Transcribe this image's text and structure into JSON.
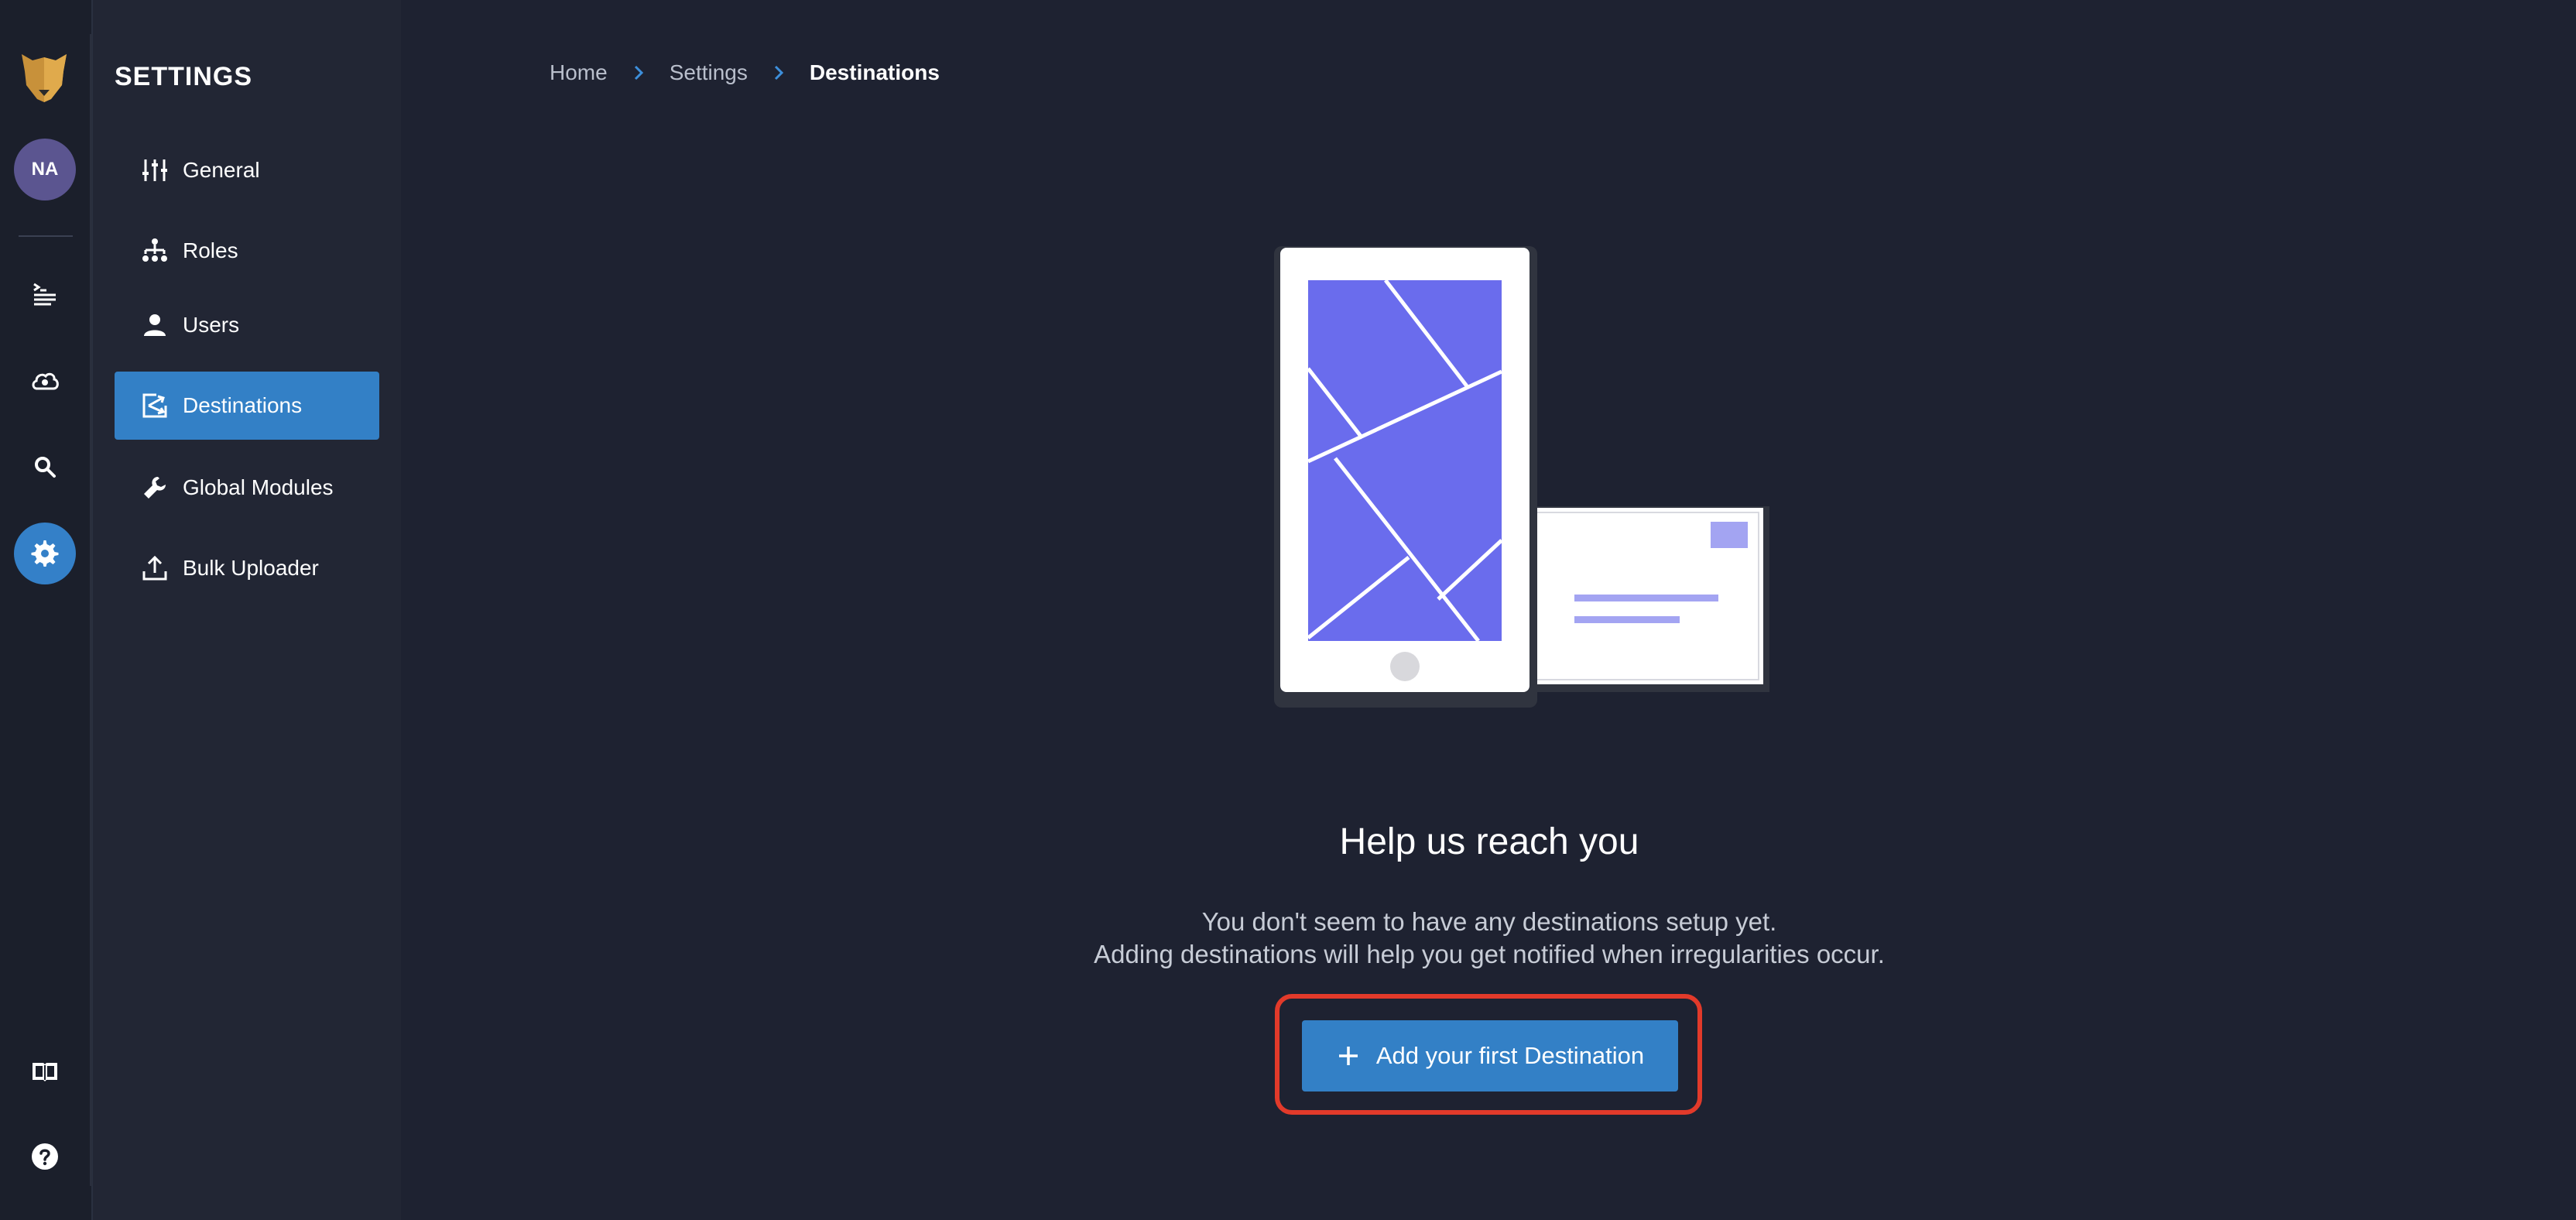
{
  "rail": {
    "avatar_initials": "NA",
    "items": [
      {
        "icon": "logs-icon",
        "active": false
      },
      {
        "icon": "cloud-eye-icon",
        "active": false
      },
      {
        "icon": "search-icon",
        "active": false
      },
      {
        "icon": "gear-icon",
        "active": true
      }
    ],
    "bottom_items": [
      {
        "icon": "book-icon"
      },
      {
        "icon": "help-icon"
      }
    ]
  },
  "sidebar": {
    "title": "SETTINGS",
    "items": [
      {
        "label": "General",
        "icon": "sliders-icon",
        "active": false
      },
      {
        "label": "Roles",
        "icon": "hierarchy-icon",
        "active": false
      },
      {
        "label": "Users",
        "icon": "user-icon",
        "active": false
      },
      {
        "label": "Destinations",
        "icon": "destinations-icon",
        "active": true
      },
      {
        "label": "Global Modules",
        "icon": "wrench-icon",
        "active": false
      },
      {
        "label": "Bulk Uploader",
        "icon": "upload-icon",
        "active": false
      }
    ]
  },
  "breadcrumb": [
    "Home",
    "Settings",
    "Destinations"
  ],
  "empty_state": {
    "title": "Help us reach you",
    "line1": "You don't seem to have any destinations setup yet.",
    "line2": "Adding destinations will help you get notified when irregularities occur.",
    "button_label": "Add your first Destination"
  },
  "colors": {
    "accent": "#3380c6",
    "highlight": "#e23a2a",
    "illustration": "#6a6ced"
  }
}
